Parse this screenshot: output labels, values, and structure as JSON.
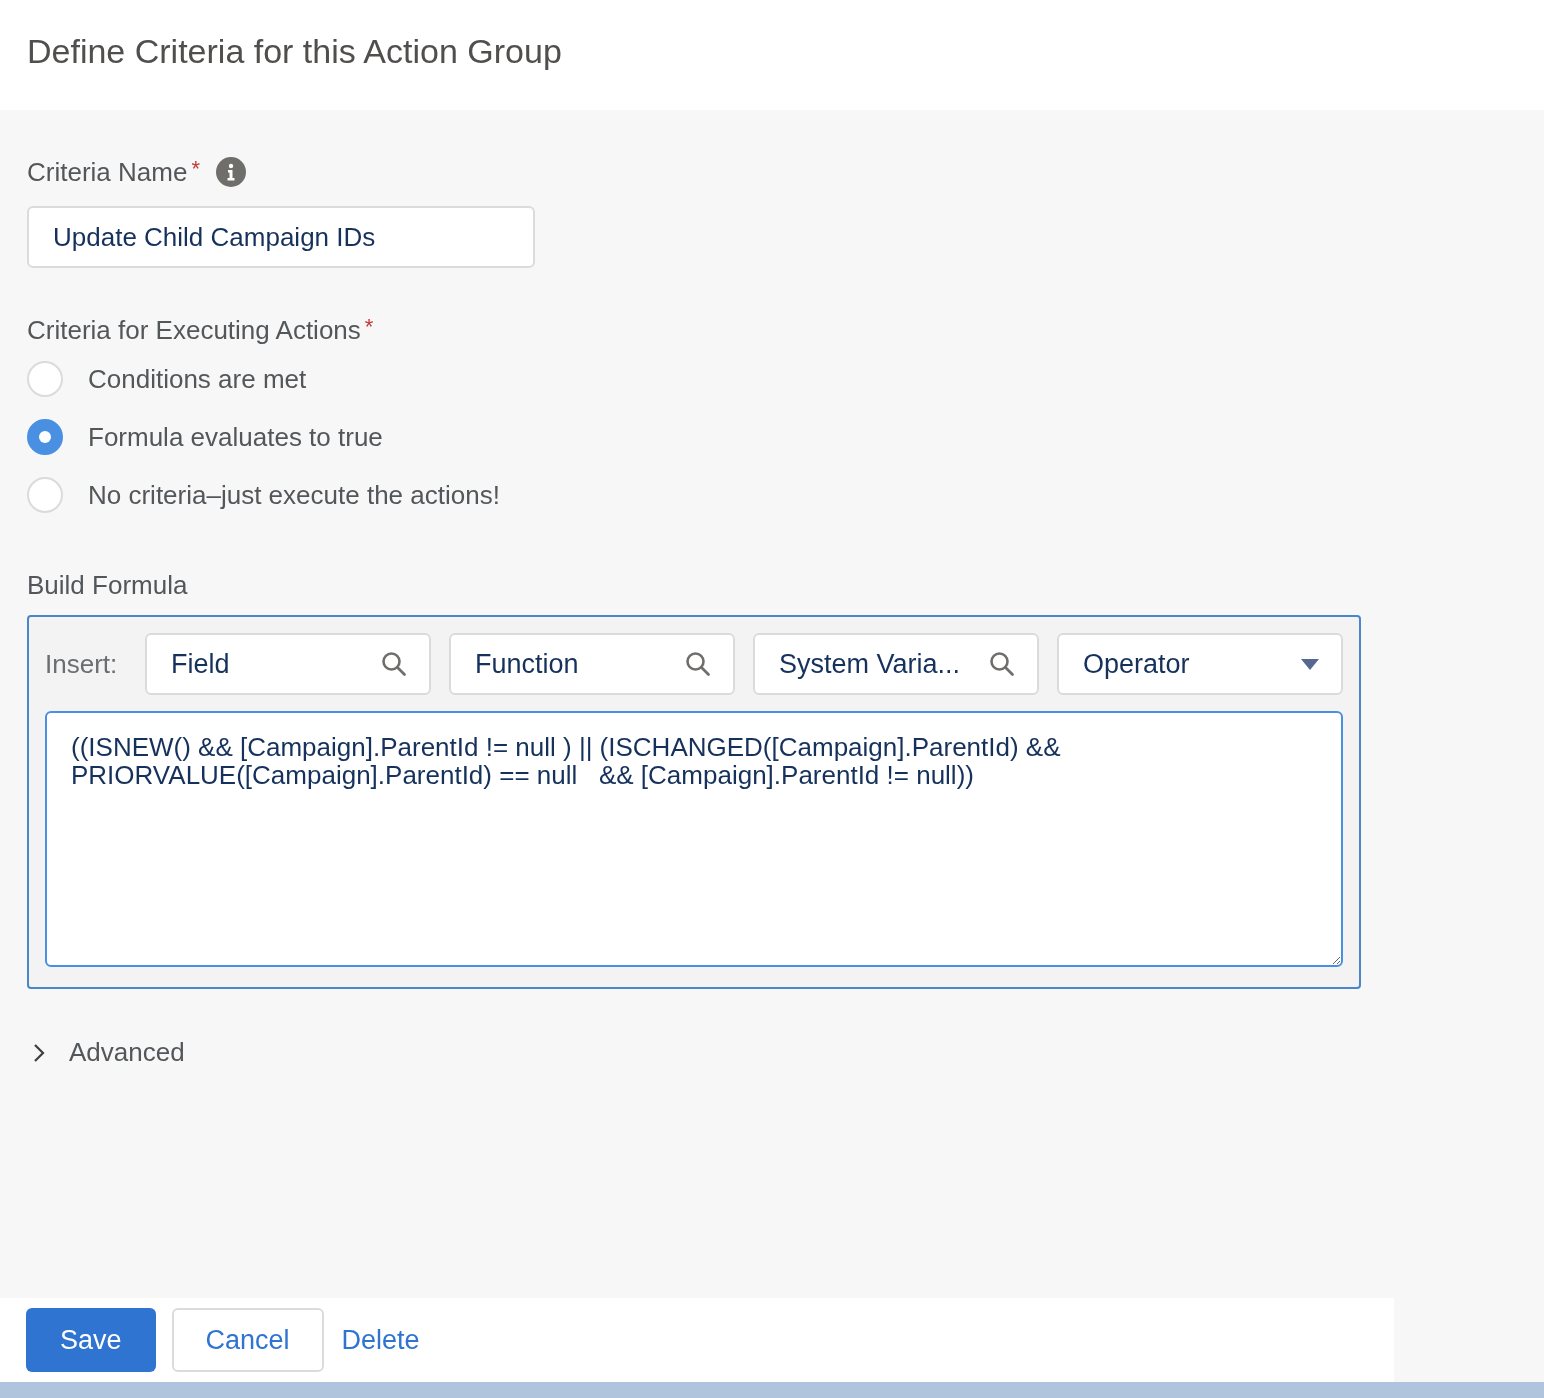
{
  "title": "Define Criteria for this Action Group",
  "criteria_name": {
    "label": "Criteria Name",
    "required_mark": "*",
    "info": true,
    "value": "Update Child Campaign IDs"
  },
  "criteria_for_executing": {
    "label": "Criteria for Executing Actions",
    "required_mark": "*",
    "options": [
      {
        "label": "Conditions are met",
        "selected": false
      },
      {
        "label": "Formula evaluates to true",
        "selected": true
      },
      {
        "label": "No criteria–just execute the actions!",
        "selected": false
      }
    ]
  },
  "build_formula": {
    "label": "Build Formula",
    "insert_label": "Insert:",
    "pickers": [
      {
        "kind": "search",
        "label": "Field"
      },
      {
        "kind": "search",
        "label": "Function"
      },
      {
        "kind": "search",
        "label": "System Varia..."
      },
      {
        "kind": "dropdown",
        "label": "Operator"
      }
    ],
    "formula": "((ISNEW() && [Campaign].ParentId != null ) || (ISCHANGED([Campaign].ParentId) && PRIORVALUE([Campaign].ParentId) == null   && [Campaign].ParentId != null))"
  },
  "advanced": {
    "label": "Advanced",
    "expanded": false
  },
  "buttons": [
    {
      "kind": "primary",
      "label": "Save"
    },
    {
      "kind": "neutral",
      "label": "Cancel"
    },
    {
      "kind": "link",
      "label": "Delete"
    }
  ]
}
